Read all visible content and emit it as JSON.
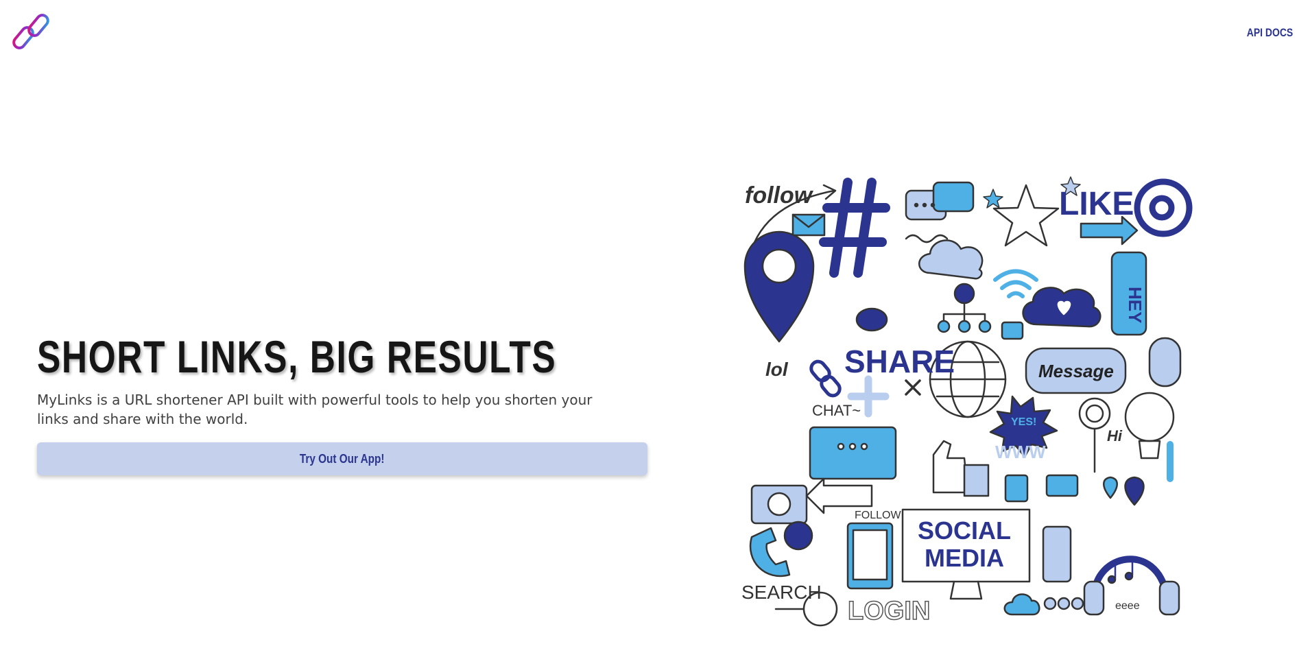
{
  "nav": {
    "logo_icon": "link-chain-icon",
    "api_docs_label": "API DOCS"
  },
  "hero": {
    "title": "SHORT LINKS, BIG RESULTS",
    "description": "MyLinks is a URL shortener API built with powerful tools to help you shorten your links and share with the world.",
    "cta_label": "Try Out Our App!"
  },
  "illustration": {
    "follow": "follow",
    "like": "LIKE",
    "share": "SHARE",
    "lol": "lol",
    "message": "Message",
    "chat": "CHAT~",
    "yes": "YES!",
    "www": "WWW",
    "hi": "Hi",
    "hey": "HEY",
    "follow_caps": "FOLLOW",
    "social": "SOCIAL",
    "media": "MEDIA",
    "search": "SEARCH",
    "login": "LOGIN",
    "eeee": "eeee"
  },
  "colors": {
    "brand": "#2b3590",
    "accent_blue": "#4fb0e6",
    "light_blue": "#b9cdee",
    "cta_bg": "#c4d0ec",
    "title": "#161616"
  }
}
